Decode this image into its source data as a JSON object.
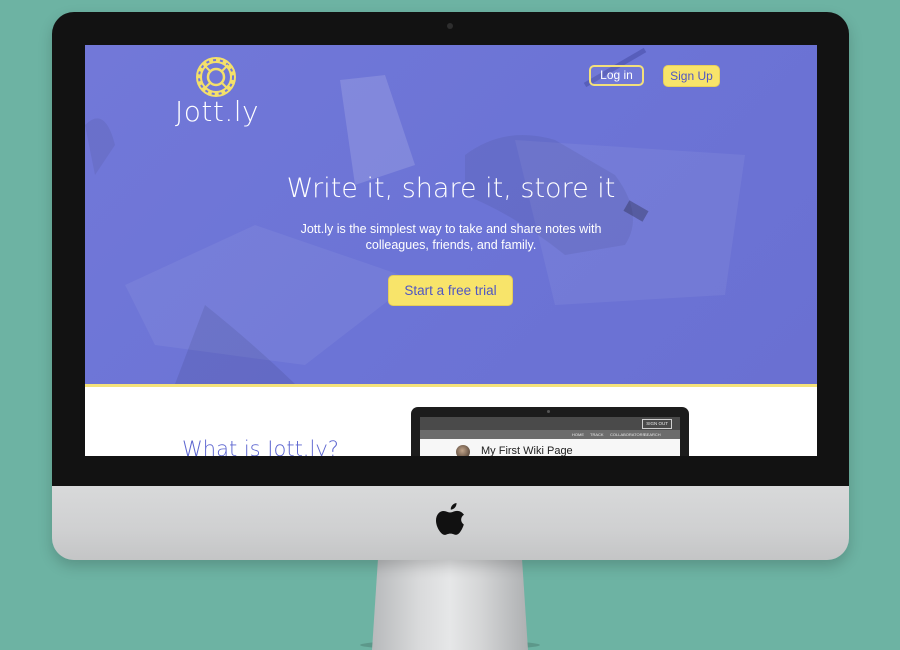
{
  "site": {
    "brand": "Jott.ly",
    "nav": {
      "login_label": "Log in",
      "signup_label": "Sign Up"
    },
    "hero": {
      "headline": "Write it, share it, store it",
      "subtext": "Jott.ly is the simplest way to take and share notes with colleagues, friends, and family.",
      "cta_label": "Start a free trial"
    },
    "section": {
      "title": "What is Jott.ly?"
    },
    "preview": {
      "signout_label": "SIGN OUT",
      "nav_items": [
        "HOME",
        "TRACK",
        "COLLABORATORS",
        "SEARCH"
      ],
      "page_title": "My First Wiki Page"
    }
  },
  "colors": {
    "background": "#6db3a3",
    "hero": "#6c74d6",
    "accent_yellow": "#f8e46a",
    "heading_blue": "#5d66d0"
  },
  "icons": [
    "jottly-logo-icon",
    "apple-logo-icon",
    "camera-icon"
  ]
}
